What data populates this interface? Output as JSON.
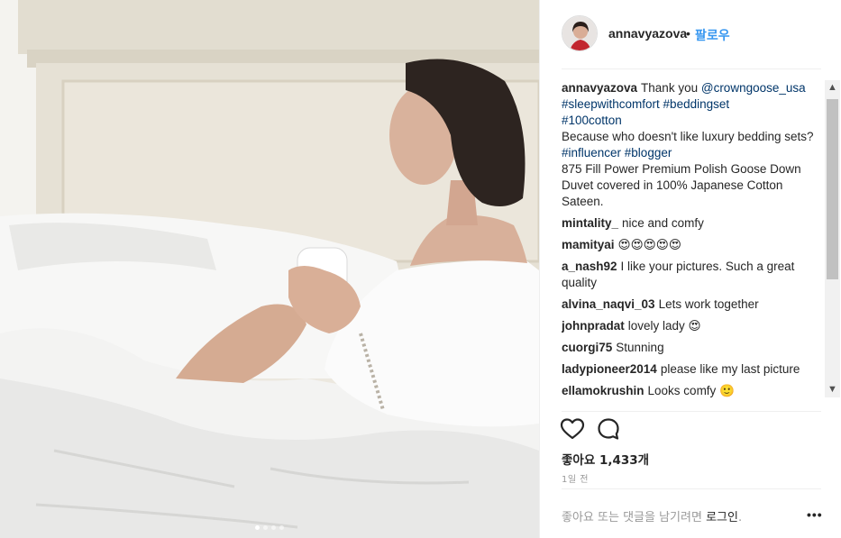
{
  "post": {
    "username": "annavyazova",
    "separator": "•",
    "follow_label": "팔로우",
    "photo_alt": "Woman with coffee cup sitting in white bed",
    "carousel": {
      "count": 4,
      "active": 0
    }
  },
  "caption": {
    "username": "annavyazova",
    "text_1": "Thank you",
    "mention": "@crowngoose_usa",
    "hashtags_1": "#sleepwithcomfort #beddingset",
    "hashtags_2": "#100cotton",
    "text_2": "Because who doesn't like luxury bedding sets?",
    "hashtags_3": "#influencer #blogger",
    "text_3": "875 Fill Power Premium Polish Goose Down Duvet covered in 100% Japanese Cotton Sateen."
  },
  "comments": [
    {
      "user": "mintality_",
      "text": "nice and comfy"
    },
    {
      "user": "mamityai",
      "text": "😍😍😍😍😍"
    },
    {
      "user": "a_nash92",
      "text": "I like your pictures. Such a great quality"
    },
    {
      "user": "alvina_naqvi_03",
      "text": "Lets work together"
    },
    {
      "user": "johnpradat",
      "text": "lovely lady 😍"
    },
    {
      "user": "cuorgi75",
      "text": "Stunning"
    },
    {
      "user": "ladypioneer2014",
      "text": "please like my last picture"
    },
    {
      "user": "ellamokrushin",
      "text": "Looks comfy 🙂"
    }
  ],
  "likes": {
    "label": "좋아요",
    "count": "1,433개"
  },
  "time": "1일 전",
  "footer": {
    "prompt": "좋아요 또는 댓글을 남기려면",
    "login": "로그인",
    "end": ".",
    "more": "•••"
  },
  "icons": {
    "like": "heart-icon",
    "comment": "comment-icon",
    "more": "more-options-icon"
  },
  "colors": {
    "accent": "#3897f0",
    "link": "#003569",
    "text": "#262626",
    "muted": "#999999"
  }
}
